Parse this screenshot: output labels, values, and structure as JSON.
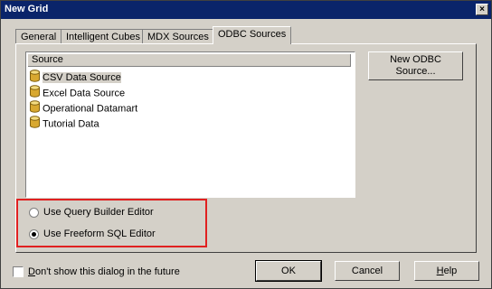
{
  "window": {
    "title": "New Grid",
    "close_glyph": "×"
  },
  "tabs": [
    {
      "label": "General",
      "active": false
    },
    {
      "label": "Intelligent Cubes",
      "active": false
    },
    {
      "label": "MDX Sources",
      "active": false
    },
    {
      "label": "ODBC Sources",
      "active": true
    }
  ],
  "source_list": {
    "header": "Source",
    "items": [
      {
        "label": "CSV Data Source",
        "selected": true,
        "icon": "database-icon"
      },
      {
        "label": "Excel Data Source",
        "selected": false,
        "icon": "database-icon"
      },
      {
        "label": "Operational Datamart",
        "selected": false,
        "icon": "database-icon"
      },
      {
        "label": "Tutorial Data",
        "selected": false,
        "icon": "database-icon"
      }
    ]
  },
  "new_odbc_button": {
    "line1": "New ODBC",
    "line2": "Source..."
  },
  "editor_options": [
    {
      "label": "Use Query Builder Editor",
      "checked": false
    },
    {
      "label": "Use Freeform SQL Editor",
      "checked": true
    }
  ],
  "dont_show": {
    "prefix": "D",
    "rest": "on't show this dialog in the future",
    "checked": false
  },
  "buttons": {
    "ok": "OK",
    "cancel": "Cancel",
    "help_prefix": "H",
    "help_rest": "elp"
  },
  "colors": {
    "title_bar": "#0a246a",
    "highlight_border": "#e02020",
    "dialog_bg": "#d4d0c8"
  }
}
